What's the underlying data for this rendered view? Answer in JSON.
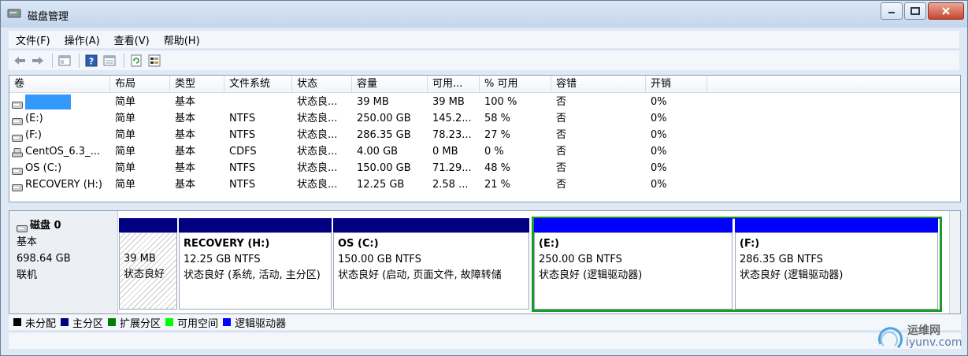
{
  "window": {
    "title": "磁盘管理"
  },
  "menu": [
    "文件(F)",
    "操作(A)",
    "查看(V)",
    "帮助(H)"
  ],
  "volume_table": {
    "columns": [
      "卷",
      "布局",
      "类型",
      "文件系统",
      "状态",
      "容量",
      "可用...",
      "% 可用",
      "容错",
      "开销"
    ],
    "rows": [
      {
        "volume": "",
        "layout": "简单",
        "type": "基本",
        "fs": "",
        "status": "状态良...",
        "capacity": "39 MB",
        "free": "39 MB",
        "pct": "100 %",
        "fault": "否",
        "overhead": "0%",
        "icon": "disk-volume-icon",
        "selected": true
      },
      {
        "volume": "(E:)",
        "layout": "简单",
        "type": "基本",
        "fs": "NTFS",
        "status": "状态良...",
        "capacity": "250.00 GB",
        "free": "145.2...",
        "pct": "58 %",
        "fault": "否",
        "overhead": "0%",
        "icon": "disk-volume-icon"
      },
      {
        "volume": "(F:)",
        "layout": "简单",
        "type": "基本",
        "fs": "NTFS",
        "status": "状态良...",
        "capacity": "286.35 GB",
        "free": "78.23...",
        "pct": "27 %",
        "fault": "否",
        "overhead": "0%",
        "icon": "disk-volume-icon"
      },
      {
        "volume": "CentOS_6.3_...",
        "layout": "简单",
        "type": "基本",
        "fs": "CDFS",
        "status": "状态良...",
        "capacity": "4.00 GB",
        "free": "0 MB",
        "pct": "0 %",
        "fault": "否",
        "overhead": "0%",
        "icon": "cd-drive-icon"
      },
      {
        "volume": "OS (C:)",
        "layout": "简单",
        "type": "基本",
        "fs": "NTFS",
        "status": "状态良...",
        "capacity": "150.00 GB",
        "free": "71.29...",
        "pct": "48 %",
        "fault": "否",
        "overhead": "0%",
        "icon": "disk-volume-icon"
      },
      {
        "volume": "RECOVERY (H:)",
        "layout": "简单",
        "type": "基本",
        "fs": "NTFS",
        "status": "状态良...",
        "capacity": "12.25 GB",
        "free": "2.58 ...",
        "pct": "21 %",
        "fault": "否",
        "overhead": "0%",
        "icon": "disk-volume-icon"
      }
    ]
  },
  "disk": {
    "name": "磁盘 0",
    "type": "基本",
    "size": "698.64 GB",
    "state": "联机",
    "partitions": [
      {
        "title": "",
        "size": "39 MB",
        "status": "状态良好",
        "bar_color": "#000080",
        "hatched": true
      },
      {
        "title": "RECOVERY  (H:)",
        "size": "12.25 GB NTFS",
        "status": "状态良好 (系统, 活动, 主分区)",
        "bar_color": "#000080"
      },
      {
        "title": "OS  (C:)",
        "size": "150.00 GB NTFS",
        "status": "状态良好 (启动, 页面文件, 故障转储",
        "bar_color": "#000080"
      },
      {
        "title": "(E:)",
        "size": "250.00 GB NTFS",
        "status": "状态良好 (逻辑驱动器)",
        "bar_color": "#0000ff"
      },
      {
        "title": "(F:)",
        "size": "286.35 GB NTFS",
        "status": "状态良好 (逻辑驱动器)",
        "bar_color": "#0000ff"
      }
    ]
  },
  "legend": [
    {
      "label": "未分配",
      "color": "#000000"
    },
    {
      "label": "主分区",
      "color": "#000080"
    },
    {
      "label": "扩展分区",
      "color": "#008000"
    },
    {
      "label": "可用空间",
      "color": "#00ff00"
    },
    {
      "label": "逻辑驱动器",
      "color": "#0000ff"
    }
  ],
  "watermark": {
    "top": "运维网",
    "bottom": "iyunv.com"
  }
}
